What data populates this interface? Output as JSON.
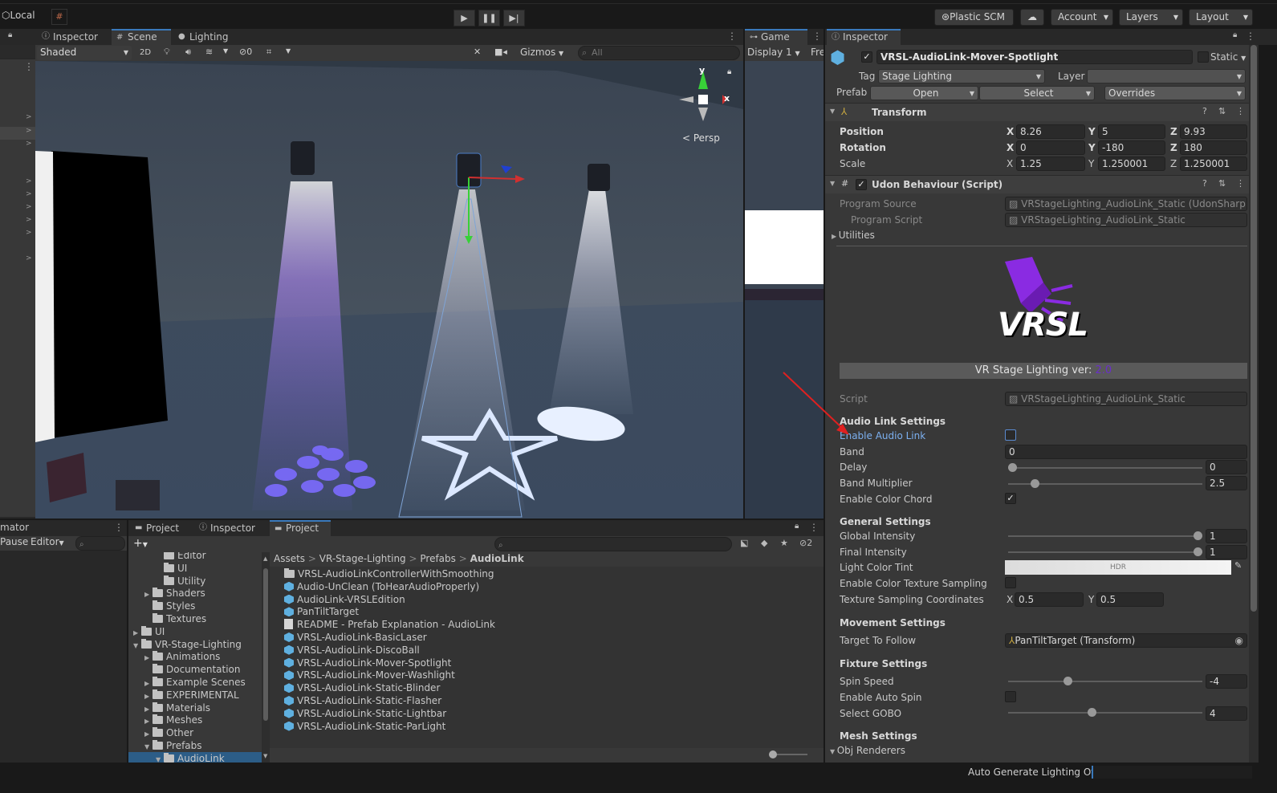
{
  "toolbar": {
    "local": "Local",
    "plastic": "Plastic SCM",
    "account": "Account",
    "layers": "Layers",
    "layout": "Layout"
  },
  "left_tabs": {
    "inspector": "Inspector",
    "scene": "Scene",
    "lighting": "Lighting"
  },
  "scene": {
    "shading": "Shaded",
    "mode2d": "2D",
    "hidden_count": "0",
    "gizmos": "Gizmos",
    "search_placeholder": "All",
    "persp": "< Persp",
    "axis_x": "x",
    "axis_y": "y"
  },
  "game": {
    "tab": "Game",
    "display": "Display 1",
    "free": "Fre"
  },
  "inspector": {
    "tab": "Inspector",
    "name": "VRSL-AudioLink-Mover-Spotlight",
    "static": "Static",
    "tag_label": "Tag",
    "tag_value": "Stage Lighting",
    "layer_label": "Layer",
    "layer_value": "",
    "prefab_label": "Prefab",
    "open": "Open",
    "select": "Select",
    "overrides": "Overrides",
    "transform": {
      "title": "Transform",
      "position": {
        "label": "Position",
        "x": "8.26",
        "y": "5",
        "z": "9.93"
      },
      "rotation": {
        "label": "Rotation",
        "x": "0",
        "y": "-180",
        "z": "180"
      },
      "scale": {
        "label": "Scale",
        "x": "1.25",
        "y": "1.250001",
        "z": "1.250001"
      }
    },
    "udon": {
      "title": "Udon Behaviour (Script)",
      "program_source_label": "Program Source",
      "program_source": "VRStageLighting_AudioLink_Static (UdonSharpP",
      "program_script_label": "Program Script",
      "program_script": "VRStageLighting_AudioLink_Static",
      "utilities": "Utilities"
    },
    "logo_text": "VRSL",
    "version_label": "VR Stage Lighting ver: ",
    "version": "2.0",
    "script_label": "Script",
    "script_value": "VRStageLighting_AudioLink_Static",
    "audio_link": {
      "header": "Audio Link Settings",
      "enable_label": "Enable Audio Link",
      "band_label": "Band",
      "band": "0",
      "delay_label": "Delay",
      "delay": "0",
      "delay_level": 0.0,
      "band_mult_label": "Band Multiplier",
      "band_mult": "2.5",
      "band_mult_level": 0.12,
      "color_chord_label": "Enable Color Chord"
    },
    "general": {
      "header": "General Settings",
      "global_label": "Global Intensity",
      "global": "1",
      "global_level": 1.0,
      "final_label": "Final Intensity",
      "final": "1",
      "final_level": 1.0,
      "tint_label": "Light Color Tint",
      "hdr": "HDR",
      "tex_sampling_label": "Enable Color Texture Sampling",
      "tex_coords_label": "Texture Sampling Coordinates",
      "tex_x": "0.5",
      "tex_y": "0.5"
    },
    "movement": {
      "header": "Movement Settings",
      "target_label": "Target To Follow",
      "target": "PanTiltTarget (Transform)"
    },
    "fixture": {
      "header": "Fixture Settings",
      "spin_label": "Spin Speed",
      "spin": "-4",
      "spin_level": 0.3,
      "auto_spin_label": "Enable Auto Spin",
      "gobo_label": "Select GOBO",
      "gobo": "4",
      "gobo_level": 0.43
    },
    "mesh": {
      "header": "Mesh Settings",
      "obj_renderers": "Obj Renderers"
    }
  },
  "bottom": {
    "animator_tab": "mator",
    "pause": "Pause",
    "editor": "Editor",
    "tabs": [
      "Project",
      "Inspector",
      "Project"
    ],
    "hidden_count": "2",
    "breadcrumb": [
      "Assets",
      "VR-Stage-Lighting",
      "Prefabs",
      "AudioLink"
    ],
    "tree": [
      {
        "label": "Editor",
        "indent": 3,
        "arrow": ""
      },
      {
        "label": "UI",
        "indent": 3,
        "arrow": ""
      },
      {
        "label": "Utility",
        "indent": 3,
        "arrow": ""
      },
      {
        "label": "Shaders",
        "indent": 2,
        "arrow": "▶"
      },
      {
        "label": "Styles",
        "indent": 2,
        "arrow": ""
      },
      {
        "label": "Textures",
        "indent": 2,
        "arrow": ""
      },
      {
        "label": "UI",
        "indent": 1,
        "arrow": "▶"
      },
      {
        "label": "VR-Stage-Lighting",
        "indent": 1,
        "arrow": "▼"
      },
      {
        "label": "Animations",
        "indent": 2,
        "arrow": "▶"
      },
      {
        "label": "Documentation",
        "indent": 2,
        "arrow": ""
      },
      {
        "label": "Example Scenes",
        "indent": 2,
        "arrow": "▶"
      },
      {
        "label": "EXPERIMENTAL",
        "indent": 2,
        "arrow": "▶"
      },
      {
        "label": "Materials",
        "indent": 2,
        "arrow": "▶"
      },
      {
        "label": "Meshes",
        "indent": 2,
        "arrow": "▶"
      },
      {
        "label": "Other",
        "indent": 2,
        "arrow": "▶"
      },
      {
        "label": "Prefabs",
        "indent": 2,
        "arrow": "▼"
      },
      {
        "label": "AudioLink",
        "indent": 3,
        "arrow": "▼"
      }
    ],
    "files": [
      {
        "label": "VRSL-AudioLinkControllerWithSmoothing",
        "icon": "folder"
      },
      {
        "label": "Audio-UnClean (ToHearAudioProperly)",
        "icon": "cube"
      },
      {
        "label": "AudioLink-VRSLEdition",
        "icon": "cube"
      },
      {
        "label": "PanTiltTarget",
        "icon": "cube"
      },
      {
        "label": "README - Prefab Explanation - AudioLink",
        "icon": "doc"
      },
      {
        "label": "VRSL-AudioLink-BasicLaser",
        "icon": "cube"
      },
      {
        "label": "VRSL-AudioLink-DiscoBall",
        "icon": "cube"
      },
      {
        "label": "VRSL-AudioLink-Mover-Spotlight",
        "icon": "cube"
      },
      {
        "label": "VRSL-AudioLink-Mover-Washlight",
        "icon": "cube"
      },
      {
        "label": "VRSL-AudioLink-Static-Blinder",
        "icon": "cube"
      },
      {
        "label": "VRSL-AudioLink-Static-Flasher",
        "icon": "cube"
      },
      {
        "label": "VRSL-AudioLink-Static-Lightbar",
        "icon": "cube"
      },
      {
        "label": "VRSL-AudioLink-Static-ParLight",
        "icon": "cube"
      }
    ]
  },
  "status": {
    "auto_lighting": "Auto Generate Lighting Off"
  },
  "colors": {
    "accent": "#3a79bb",
    "link": "#7cb0f0",
    "version": "#6a2fc8",
    "arrow": "#e02020"
  }
}
